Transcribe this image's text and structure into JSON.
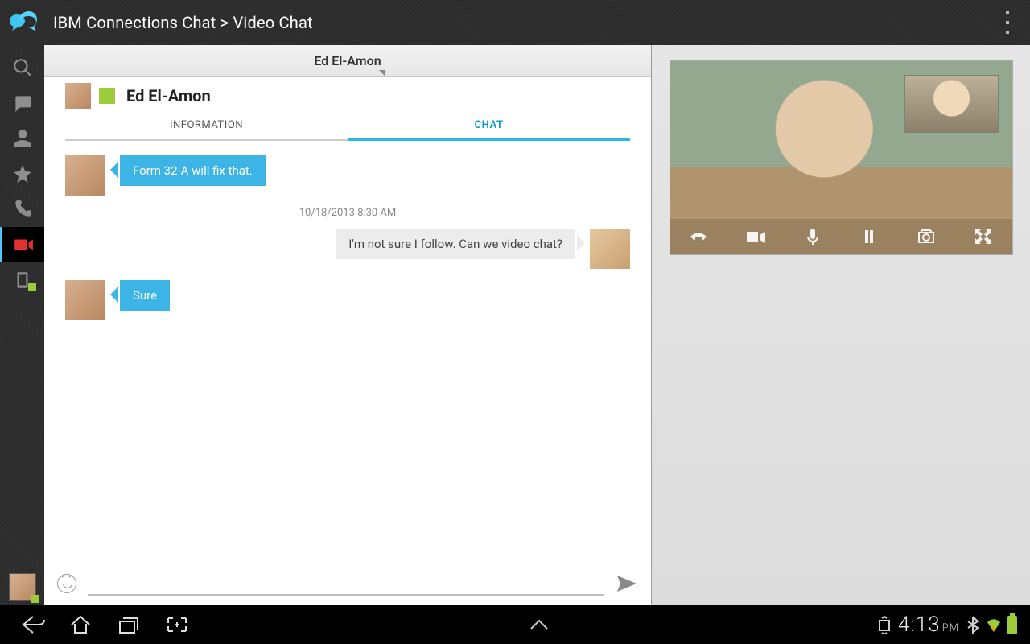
{
  "appbar": {
    "title": "IBM Connections Chat > Video Chat"
  },
  "sidebar": {
    "items": [
      {
        "name": "search"
      },
      {
        "name": "chat"
      },
      {
        "name": "contacts"
      },
      {
        "name": "favorites"
      },
      {
        "name": "calls"
      },
      {
        "name": "video",
        "active": true
      },
      {
        "name": "device"
      }
    ]
  },
  "chat": {
    "tab_title": "Ed El-Amon",
    "contact_name": "Ed El-Amon",
    "status": "available",
    "tabs": {
      "info": "INFORMATION",
      "chat": "CHAT",
      "active": "chat"
    },
    "timestamp": "10/18/2013 8:30 AM",
    "messages": [
      {
        "from": "them",
        "text": "Form 32-A will fix that."
      },
      {
        "from": "me",
        "text": "I'm not sure I follow. Can we video chat?"
      },
      {
        "from": "them",
        "text": "Sure"
      }
    ],
    "input_placeholder": ""
  },
  "video": {
    "controls": [
      "hangup",
      "camera",
      "mic",
      "pause",
      "switch-camera",
      "fullscreen"
    ]
  },
  "statusbar": {
    "time": "4:13",
    "ampm": "PM"
  }
}
